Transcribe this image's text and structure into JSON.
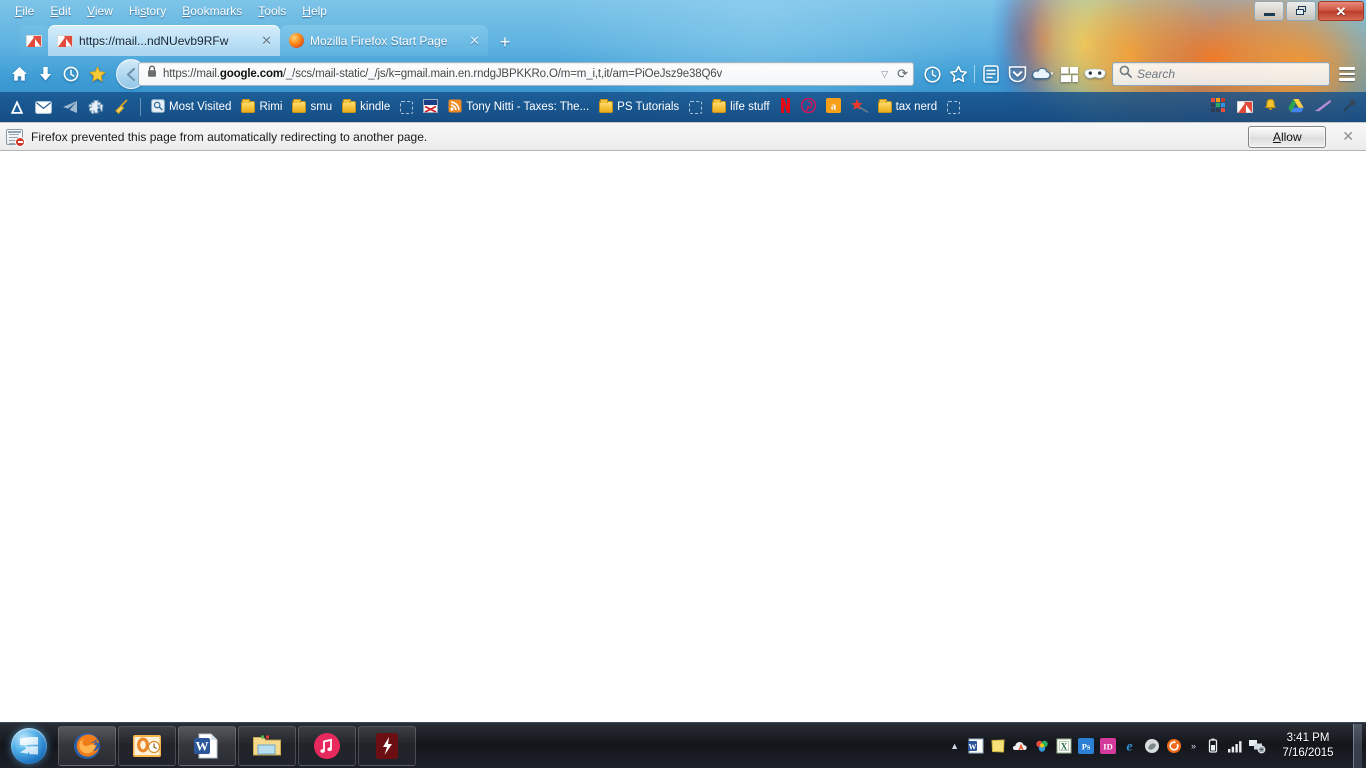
{
  "window": {
    "controls": {
      "minimize": "−",
      "restore": "❐",
      "close": "✕"
    }
  },
  "menubar": {
    "items": [
      {
        "label": "File",
        "accel": "F"
      },
      {
        "label": "Edit",
        "accel": "E"
      },
      {
        "label": "View",
        "accel": "V"
      },
      {
        "label": "History",
        "accel": "s"
      },
      {
        "label": "Bookmarks",
        "accel": "B"
      },
      {
        "label": "Tools",
        "accel": "T"
      },
      {
        "label": "Help",
        "accel": "H"
      }
    ]
  },
  "tabs": {
    "app_tab_icon": "gmail-icon",
    "items": [
      {
        "title": "https://mail...ndNUevb9RFw",
        "icon": "gmail-icon",
        "active": true,
        "close": "✕"
      },
      {
        "title": "Mozilla Firefox Start Page",
        "icon": "firefox-icon",
        "active": false,
        "close": "✕"
      }
    ],
    "new_tab": "+"
  },
  "navbar": {
    "home_icon": "home-icon",
    "downloads_icon": "download-arrow-icon",
    "history_icon": "clock-icon",
    "bookmark_star_icon": "star-icon",
    "back_icon": "back-arrow-icon",
    "url": {
      "lock_icon": "padlock-icon",
      "scheme": "https://mail.",
      "domain": "google.com",
      "path": "/_/scs/mail-static/_/js/k=gmail.main.en.rndgJBPKKRo.O/m=m_i,t,it/am=PiOeJsz9e38Q6v",
      "dropdown_icon": "chevron-down-icon",
      "reload_icon": "reload-icon"
    },
    "right_icons": [
      "history-restore-icon",
      "bookmark-star-outline-icon",
      "reading-list-icon",
      "pocket-download-icon",
      "cloud-sync-icon",
      "apps-grid-icon",
      "private-browsing-mask-icon"
    ],
    "search": {
      "icon": "search-icon",
      "placeholder": "Search",
      "value": ""
    },
    "menu_icon": "hamburger-menu-icon"
  },
  "bookmarks_toolbar": {
    "leading_icons": [
      "firefox-app-icon",
      "mail-envelope-icon",
      "paper-plane-icon",
      "puzzle-addon-icon",
      "broom-cleaner-icon"
    ],
    "items": [
      {
        "label": "Most Visited",
        "icon": "most-visited-icon"
      },
      {
        "label": "Rimi",
        "icon": "folder-icon"
      },
      {
        "label": "smu",
        "icon": "folder-icon"
      },
      {
        "label": "kindle",
        "icon": "folder-icon"
      },
      {
        "label": "",
        "icon": "dashed-placeholder-icon"
      },
      {
        "label": "",
        "icon": "efile-icon"
      },
      {
        "label": "Tony Nitti - Taxes: The...",
        "icon": "rss-feed-icon"
      },
      {
        "label": "PS Tutorials",
        "icon": "folder-icon"
      },
      {
        "label": "",
        "icon": "dashed-placeholder-icon"
      },
      {
        "label": "life stuff",
        "icon": "folder-icon"
      },
      {
        "label": "",
        "icon": "netflix-icon"
      },
      {
        "label": "",
        "icon": "pinterest-icon"
      },
      {
        "label": "",
        "icon": "amazon-icon"
      },
      {
        "label": "",
        "icon": "red-star-icon"
      },
      {
        "label": "tax nerd",
        "icon": "folder-icon"
      },
      {
        "label": "",
        "icon": "dashed-placeholder-icon"
      }
    ],
    "trailing_icons": [
      "color-grid-icon",
      "gmail-icon",
      "bell-notification-icon",
      "google-drive-icon",
      "pen-icon",
      "satellite-icon"
    ]
  },
  "notification": {
    "icon": "blocked-page-icon",
    "message": "Firefox prevented this page from automatically redirecting to another page.",
    "allow_label": "Allow",
    "allow_accel": "A",
    "close": "✕"
  },
  "taskbar": {
    "start_label": "Start",
    "items": [
      {
        "name": "firefox",
        "label": "Mozilla Firefox",
        "active": true
      },
      {
        "name": "outlook",
        "label": "Microsoft Outlook",
        "active": false
      },
      {
        "name": "word",
        "label": "Microsoft Word",
        "active": true
      },
      {
        "name": "explorer",
        "label": "Windows Explorer",
        "active": false
      },
      {
        "name": "itunes",
        "label": "iTunes",
        "active": false
      },
      {
        "name": "flash",
        "label": "Flash",
        "active": false
      }
    ],
    "tray": {
      "overflow": "▲",
      "icons": [
        "word-icon",
        "sticky-note-icon",
        "adobe-creative-cloud-icon",
        "dropbox-icon",
        "excel-icon",
        "photoshop-icon",
        "indesign-icon",
        "internet-explorer-icon",
        "grey-circle-icon",
        "orange-sync-icon"
      ],
      "more": "»",
      "system_icons": [
        "battery-icon",
        "network-signal-icon",
        "action-center-icon"
      ]
    },
    "clock": {
      "time": "3:41 PM",
      "date": "7/16/2015"
    }
  },
  "colors": {
    "chrome_blue": "#3f9ed6",
    "bookmarks_bar": "#15528c",
    "accent_orange": "#ff8c1a",
    "close_red": "#cf5340",
    "taskbar": "#12141a",
    "content_bg": "#ffffff"
  }
}
